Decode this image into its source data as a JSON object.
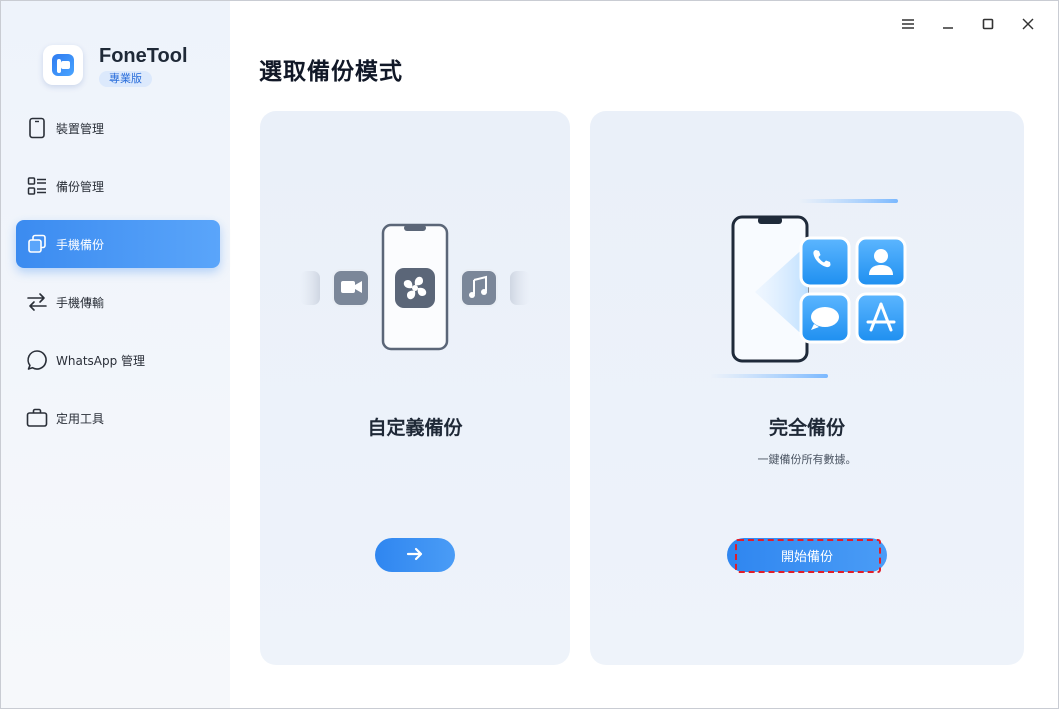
{
  "app": {
    "name": "FoneTool",
    "edition": "專業版"
  },
  "colors": {
    "accent": "#3b8bf0",
    "highlight": "#e11d2a"
  },
  "window_controls": [
    {
      "name": "menu-icon"
    },
    {
      "name": "minimize-icon"
    },
    {
      "name": "maximize-icon"
    },
    {
      "name": "close-icon"
    }
  ],
  "sidebar": {
    "items": [
      {
        "label": "裝置管理",
        "icon": "phone-icon",
        "active": false
      },
      {
        "label": "備份管理",
        "icon": "list-icon",
        "active": false
      },
      {
        "label": "手機備份",
        "icon": "copy-icon",
        "active": true
      },
      {
        "label": "手機傳輸",
        "icon": "transfer-icon",
        "active": false
      },
      {
        "label": "WhatsApp 管理",
        "icon": "chat-icon",
        "active": false
      },
      {
        "label": "定用工具",
        "icon": "toolbox-icon",
        "active": false
      }
    ]
  },
  "main": {
    "title": "選取備份模式",
    "custom_backup": {
      "title": "自定義備份",
      "button_icon": "arrow-right-icon"
    },
    "full_backup": {
      "title": "完全備份",
      "subtitle": "一鍵備份所有數據。",
      "button_label": "開始備份"
    }
  }
}
